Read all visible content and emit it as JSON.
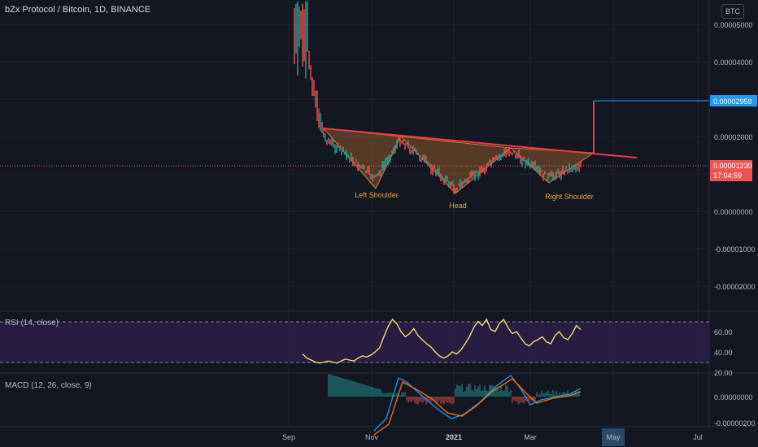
{
  "header": {
    "title": "bZx Protocol / Bitcoin, 1D, BINANCE",
    "currency_button": "BTC"
  },
  "colors": {
    "background": "#131722",
    "up_candle": "#26a69a",
    "down_candle": "#ef5350",
    "neckline": "#f23645",
    "pattern_fill": "#8d5a2b",
    "target_line": "#2196f3",
    "rsi_line": "#f5d66b",
    "rsi_band": "#2a1e45",
    "macd_line": "#2196f3",
    "signal_line": "#ff6d00"
  },
  "price_axis": {
    "ticks": [
      "0.00005000",
      "0.00004000",
      "0.00002000",
      "0.00000000",
      "-0.00001000",
      "-0.00002000"
    ],
    "target_label": "0.00002959",
    "current_price": "0.00001230",
    "countdown": "17:04:59"
  },
  "time_axis": {
    "labels": [
      "Sep",
      "Nov",
      "2021",
      "Mar",
      "May",
      "Jul"
    ],
    "highlighted": "May"
  },
  "pattern": {
    "labels": [
      "Left Shoulder",
      "Head",
      "Right Shoulder"
    ]
  },
  "rsi": {
    "label": "RSI (14, close)",
    "ticks": [
      "60.00",
      "40.00",
      "20.00"
    ],
    "series": [
      38,
      34,
      32,
      30,
      29,
      30,
      31,
      30,
      29,
      31,
      33,
      32,
      31,
      34,
      36,
      35,
      37,
      40,
      44,
      55,
      65,
      72,
      68,
      60,
      55,
      58,
      63,
      56,
      52,
      48,
      45,
      40,
      36,
      34,
      36,
      40,
      38,
      42,
      48,
      55,
      64,
      70,
      66,
      72,
      62,
      60,
      68,
      72,
      64,
      58,
      60,
      54,
      48,
      46,
      50,
      52,
      55,
      50,
      48,
      56,
      60,
      54,
      52,
      58,
      66,
      62
    ]
  },
  "macd": {
    "label": "MACD (12, 26, close, 9)",
    "ticks": [
      "0.00000000",
      "-0.00000200"
    ]
  }
}
